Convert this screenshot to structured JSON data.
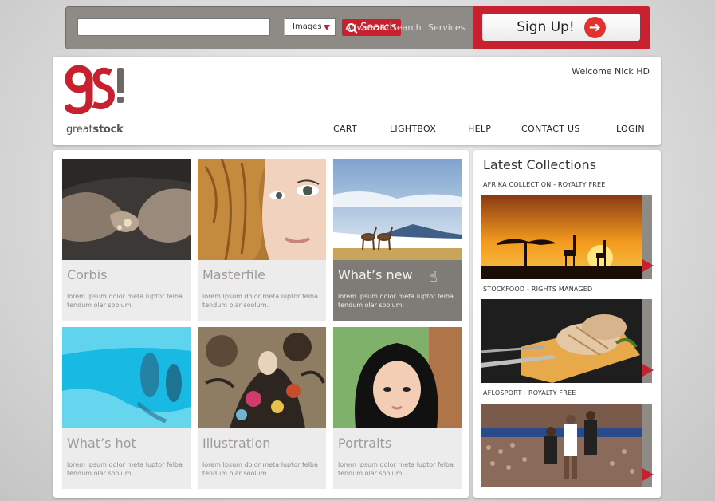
{
  "topbar": {
    "search_value": "",
    "search_type": "Images",
    "search_label": "Search",
    "advanced_search": "Advanced Search",
    "services": "Services",
    "signup_label": "Sign Up!"
  },
  "header": {
    "logo_mark": "gs!",
    "logo_prefix": "great",
    "logo_suffix": "stock",
    "welcome": "Welcome Nick HD",
    "nav": [
      "CART",
      "LIGHTBOX",
      "HELP",
      "CONTACT US",
      "LOGIN"
    ]
  },
  "gallery": {
    "tiles": [
      {
        "title": "Corbis",
        "desc": "lorem Ipsum dolor meta luptor felba tendum olar soolum."
      },
      {
        "title": "Masterfile",
        "desc": "lorem Ipsum dolor meta luptor felba tendum olar soolum."
      },
      {
        "title": "What’s new",
        "desc": "lorem Ipsum dolor meta luptor felba tendum olar soolum."
      },
      {
        "title": "What’s hot",
        "desc": "lorem Ipsum dolor meta luptor felba tendum olar soolum."
      },
      {
        "title": "Illustration",
        "desc": "lorem Ipsum dolor meta luptor felba tendum olar soolum."
      },
      {
        "title": "Portraits",
        "desc": "lorem Ipsum dolor meta luptor felba tendum olar soolum."
      }
    ]
  },
  "sidebar": {
    "title": "Latest Collections",
    "collections": [
      {
        "label": "AFRIKA COLLECTION - ROYALTY FREE"
      },
      {
        "label": "STOCKFOOD - RIGHTS MANAGED"
      },
      {
        "label": "AFLOSPORT - ROYALTY FREE"
      }
    ]
  },
  "colors": {
    "accent": "#c8202f",
    "panel_gray": "#8e8a85",
    "tile_bg": "#ececec"
  }
}
